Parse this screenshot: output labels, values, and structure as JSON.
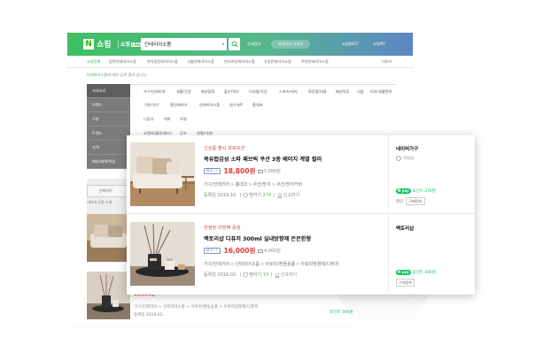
{
  "header": {
    "logo_letter": "N",
    "logo_text": "쇼핑",
    "live_text": "쇼핑",
    "live_badge": "LIVE",
    "search_value": "인테리어소품",
    "search_dropdown": "▾",
    "link_price_compare": "상세검색",
    "pill_text": "카테고리 더보기",
    "link_best": "쇼핑BEST",
    "link_my": "쇼핑MY"
  },
  "nav": {
    "items": [
      "쇼핑전체",
      "원목인테리어소품",
      "북유럽인테리어소품",
      "식물인테리어소품",
      "빈티지인테리어소품",
      "유럽인테리어소품",
      "주방인테리어소품"
    ],
    "more": "더보기"
  },
  "notice": {
    "highlight": "인테리어소품",
    "rest": "에 대한 검색 결과 입니다."
  },
  "sidebar": {
    "items": [
      "카테고리",
      "브랜드",
      "구분",
      "트렌드",
      "가격",
      "배송/혜택/색상"
    ]
  },
  "categories": {
    "row1": [
      "가구/인테리어",
      "생활/건강",
      "패션잡화",
      "출산/육아",
      "디지털/가전",
      "스포츠/레저",
      "화장품/미용",
      "패션의류",
      "식품",
      "여가/생활편의"
    ],
    "row2": [
      "그릇/식기",
      "홈인테리어",
      "인테리어소품",
      "침구세트",
      "홈데코"
    ],
    "row3": [
      "디퓨저",
      "액자",
      "조명"
    ],
    "row4": [
      "오렌지(블루/레드)",
      "무우",
      "연령(기본)"
    ]
  },
  "bg_lower": {
    "filter_label": "인테리어",
    "filter_note": "네이버 쇼핑 소개",
    "price": "16,000원",
    "date": "등록일 2018.02.",
    "crumb": "가구/인테리어 > 인테리어소품 > 아로마/캔들용품 > 아로마방향제/디퓨저",
    "npay": "포인트 300원"
  },
  "products": [
    {
      "promo": "신상품 출시 프로모션",
      "title": "북유럽감성 소파 패브릭 쿠션 3종 베이지 계열 컬러",
      "ad_label": "광고",
      "price": "18,800원",
      "shipping": "5,000원",
      "crumb": [
        "가구/인테리어",
        "홈데코",
        "쿠션/방석",
        "쿠션/방석커버"
      ],
      "date": "등록일 2019.10.",
      "wish_label": "찜하기",
      "wish_count": "274",
      "report_label": "신고하기",
      "seller": "네이버가구",
      "grade": "빅파워",
      "npay": "N pay",
      "point": "포인트 376원",
      "tags": [
        "할인",
        "구매정보"
      ]
    },
    {
      "promo": "한정판 리빙팩 증정",
      "title": "백토리샵 디퓨저 300ml 실내방향제 은은한향",
      "ad_label": "광고",
      "price": "16,000원",
      "shipping": "4,000원",
      "crumb": [
        "가구/인테리어",
        "인테리어소품",
        "아로마/캔들용품",
        "아로마방향제/디퓨저"
      ],
      "date": "등록일 2018.02.",
      "wish_label": "찜하기",
      "wish_count": "13",
      "report_label": "신고하기",
      "seller": "백토리샵",
      "grade": "",
      "npay": "N pay",
      "point": "포인트 300원",
      "tags": [
        "구매정보"
      ]
    }
  ],
  "colors": {
    "naver_green": "#03c75a",
    "price_red": "#e4393c",
    "promo_red": "#e14a3d",
    "ad_blue": "#5575b3"
  }
}
